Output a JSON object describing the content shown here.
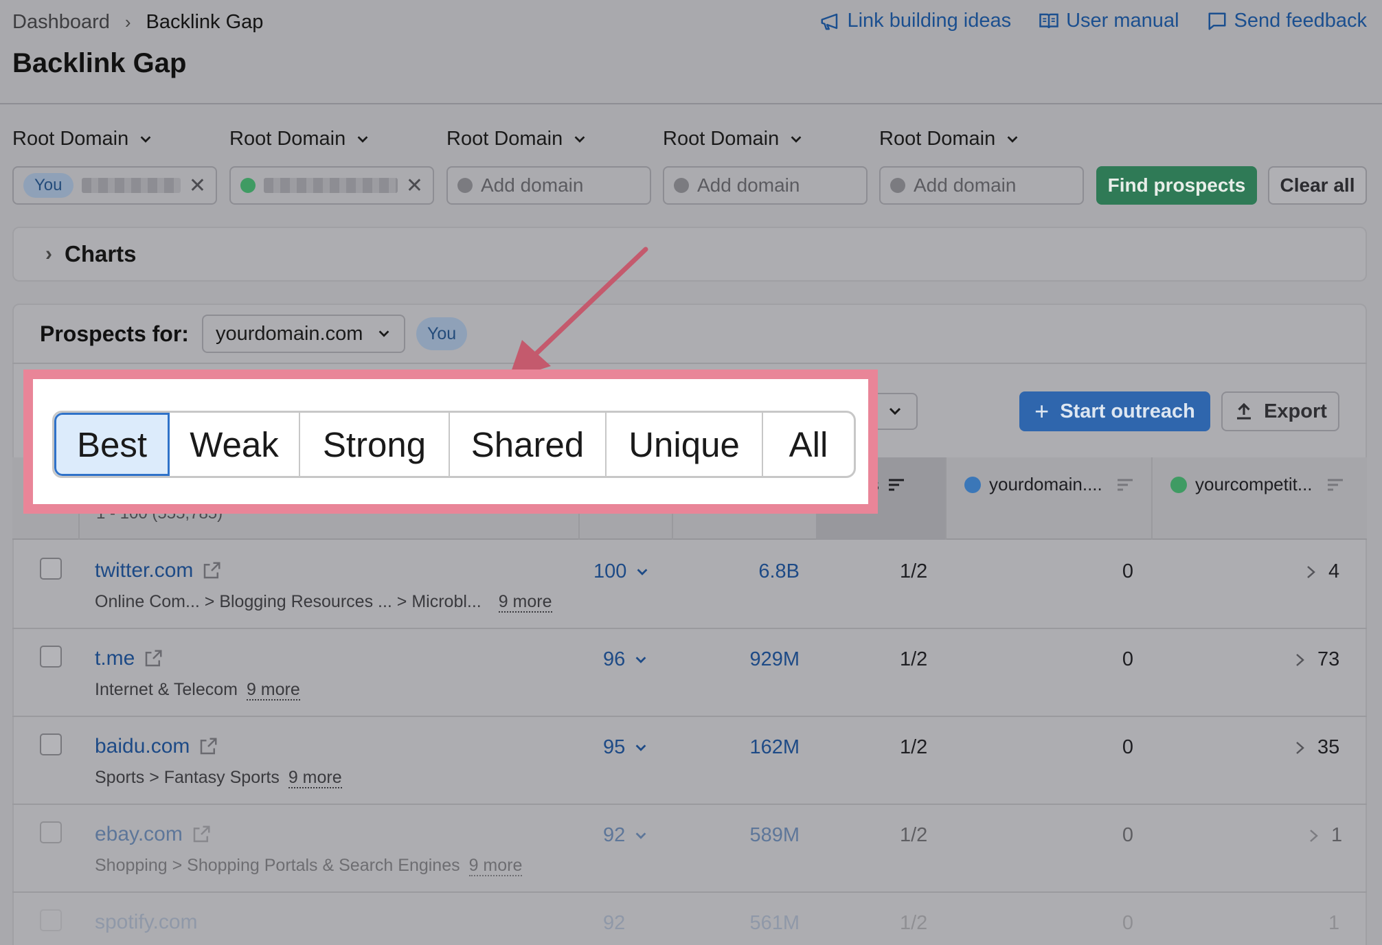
{
  "breadcrumb": {
    "parent": "Dashboard",
    "current": "Backlink Gap"
  },
  "page_title": "Backlink Gap",
  "header_links": [
    {
      "label": "Link building ideas",
      "icon": "megaphone-icon"
    },
    {
      "label": "User manual",
      "icon": "book-icon"
    },
    {
      "label": "Send feedback",
      "icon": "comment-icon"
    }
  ],
  "domain_inputs": [
    {
      "type_label": "Root Domain",
      "badge": "You",
      "placeholder": ""
    },
    {
      "type_label": "Root Domain",
      "placeholder": ""
    },
    {
      "type_label": "Root Domain",
      "placeholder": "Add domain"
    },
    {
      "type_label": "Root Domain",
      "placeholder": "Add domain"
    },
    {
      "type_label": "Root Domain",
      "placeholder": "Add domain"
    }
  ],
  "buttons": {
    "find": "Find prospects",
    "clear": "Clear all",
    "outreach": "Start outreach",
    "export": "Export"
  },
  "charts_label": "Charts",
  "prospects": {
    "label": "Prospects for:",
    "selected": "yourdomain.com",
    "badge": "You"
  },
  "segments": [
    "Best",
    "Weak",
    "Strong",
    "Shared",
    "Unique",
    "All"
  ],
  "active_segment": "Best",
  "table_header": {
    "partial_col": "nes",
    "col_you": "yourdomain....",
    "col_comp": "yourcompetit...",
    "partial_count": "1 - 100 (555,785)"
  },
  "colors": {
    "you_dot": "#3b77b8",
    "competitor_dot": "#3f9b63",
    "highlight": "#e98598",
    "active_segment": "#2f72c9"
  },
  "rows": [
    {
      "domain": "twitter.com",
      "cats": "Online Com...   > Blogging Resources ... > Microbl...",
      "more": "9 more",
      "as": "100",
      "traffic": "6.8B",
      "matches": "1/2",
      "you": "0",
      "comp": "4"
    },
    {
      "domain": "t.me",
      "cats": "Internet & Telecom",
      "more": "9 more",
      "as": "96",
      "traffic": "929M",
      "matches": "1/2",
      "you": "0",
      "comp": "73"
    },
    {
      "domain": "baidu.com",
      "cats": "Sports > Fantasy Sports",
      "more": "9 more",
      "as": "95",
      "traffic": "162M",
      "matches": "1/2",
      "you": "0",
      "comp": "35"
    },
    {
      "domain": "ebay.com",
      "cats": "Shopping > Shopping Portals & Search Engines",
      "more": "9 more",
      "as": "92",
      "traffic": "589M",
      "matches": "1/2",
      "you": "0",
      "comp": "1"
    },
    {
      "domain": "spotify.com",
      "cats": "",
      "more": "",
      "as": "92",
      "traffic": "561M",
      "matches": "1/2",
      "you": "0",
      "comp": "1"
    }
  ]
}
